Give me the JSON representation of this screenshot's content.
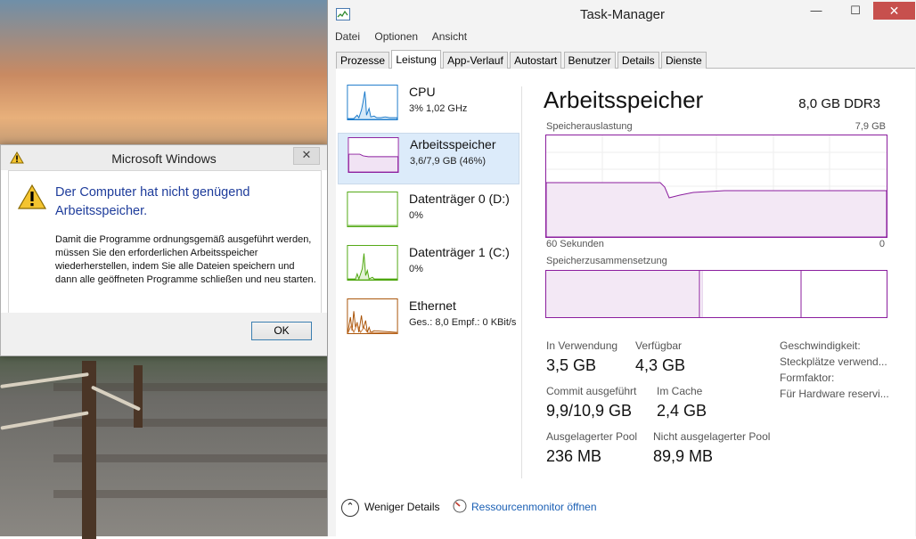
{
  "msgbox": {
    "title": "Microsoft Windows",
    "close": "✕",
    "heading": "Der Computer hat nicht genügend Arbeitsspeicher.",
    "message": "Damit die Programme ordnungsgemäß ausgeführt werden, müssen Sie den erforderlichen Arbeitsspeicher wiederherstellen, indem Sie alle Dateien speichern und dann alle geöffneten Programme schließen und neu starten.",
    "ok": "OK"
  },
  "taskmanager": {
    "title": "Task-Manager",
    "minimize": "—",
    "maximize": "☐",
    "close": "✕",
    "menu": [
      "Datei",
      "Optionen",
      "Ansicht"
    ],
    "tabs": [
      "Prozesse",
      "Leistung",
      "App-Verlauf",
      "Autostart",
      "Benutzer",
      "Details",
      "Dienste"
    ],
    "active_tab": "Leistung",
    "resources": [
      {
        "name": "CPU",
        "sub": "3% 1,02 GHz",
        "color": "#1979ca"
      },
      {
        "name": "Arbeitsspeicher",
        "sub": "3,6/7,9 GB (46%)",
        "color": "#8b1e9e"
      },
      {
        "name": "Datenträger 0 (D:)",
        "sub": "0%",
        "color": "#4da60c"
      },
      {
        "name": "Datenträger 1 (C:)",
        "sub": "0%",
        "color": "#4da60c"
      },
      {
        "name": "Ethernet",
        "sub": "Ges.: 8,0 Empf.: 0 KBit/s",
        "color": "#a74f01"
      }
    ],
    "detail": {
      "title": "Arbeitsspeicher",
      "spec": "8,0 GB DDR3",
      "usage_label": "Speicherauslastung",
      "usage_max": "7,9 GB",
      "time_label": "60 Sekunden",
      "time_end": "0",
      "composition_label": "Speicherzusammensetzung",
      "stats": {
        "in_use_label": "In Verwendung",
        "in_use": "3,5 GB",
        "available_label": "Verfügbar",
        "available": "4,3 GB",
        "commit_label": "Commit ausgeführt",
        "commit": "9,9/10,9 GB",
        "cache_label": "Im Cache",
        "cache": "2,4 GB",
        "paged_label": "Ausgelagerter Pool",
        "paged": "236 MB",
        "nonpaged_label": "Nicht ausgelagerter Pool",
        "nonpaged": "89,9 MB"
      },
      "props": [
        "Geschwindigkeit:",
        "Steckplätze verwend...",
        "Formfaktor:",
        "Für Hardware reservi..."
      ]
    },
    "footer": {
      "fewer": "Weniger Details",
      "resmon": "Ressourcenmonitor öffnen"
    }
  }
}
